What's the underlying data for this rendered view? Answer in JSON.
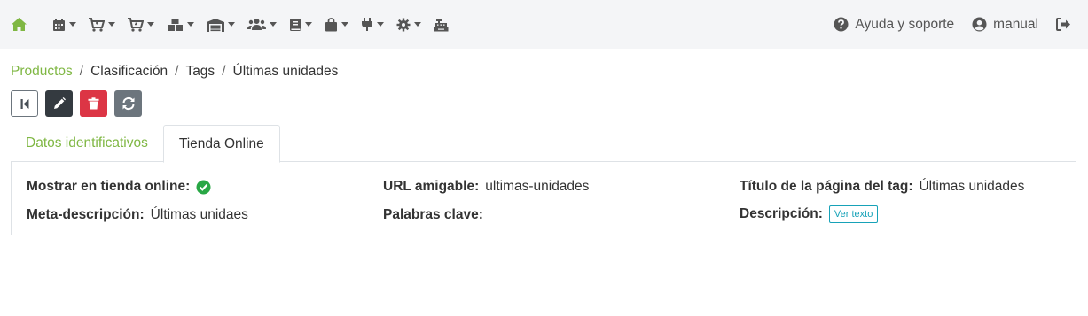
{
  "topbar": {
    "menu_icons": [
      "home-icon",
      "calendar-icon",
      "cart-icon",
      "cart-icon",
      "boxes-icon",
      "warehouse-icon",
      "users-icon",
      "book-icon",
      "shopping-bag-icon",
      "plug-icon",
      "gear-icon",
      "cash-register-icon"
    ],
    "help_label": "Ayuda y soporte",
    "user_label": "manual"
  },
  "breadcrumb": {
    "items": [
      "Productos",
      "Clasificación",
      "Tags",
      "Últimas unidades"
    ],
    "separator": "/"
  },
  "actions": {
    "icons": [
      "first-page-icon",
      "pencil-icon",
      "trash-icon",
      "sync-icon"
    ]
  },
  "tabs": [
    {
      "label": "Datos identificativos",
      "active": false
    },
    {
      "label": "Tienda Online",
      "active": true
    }
  ],
  "fields": {
    "mostrar": {
      "label": "Mostrar en tienda online:",
      "value": "check"
    },
    "url": {
      "label": "URL amigable:",
      "value": "ultimas-unidades"
    },
    "titulo": {
      "label": "Título de la página del tag:",
      "value": "Últimas unidades"
    },
    "meta": {
      "label": "Meta-descripción:",
      "value": "Últimas unidaes"
    },
    "palabras": {
      "label": "Palabras clave:",
      "value": ""
    },
    "descripcion": {
      "label": "Descripción:",
      "button": "Ver texto"
    }
  },
  "colors": {
    "accent_green": "#7fb743",
    "topbar_bg": "#f4f5f7",
    "danger": "#dc3545",
    "dark": "#343a40",
    "secondary": "#6c757d",
    "info": "#17a2b8",
    "success": "#28a745"
  }
}
